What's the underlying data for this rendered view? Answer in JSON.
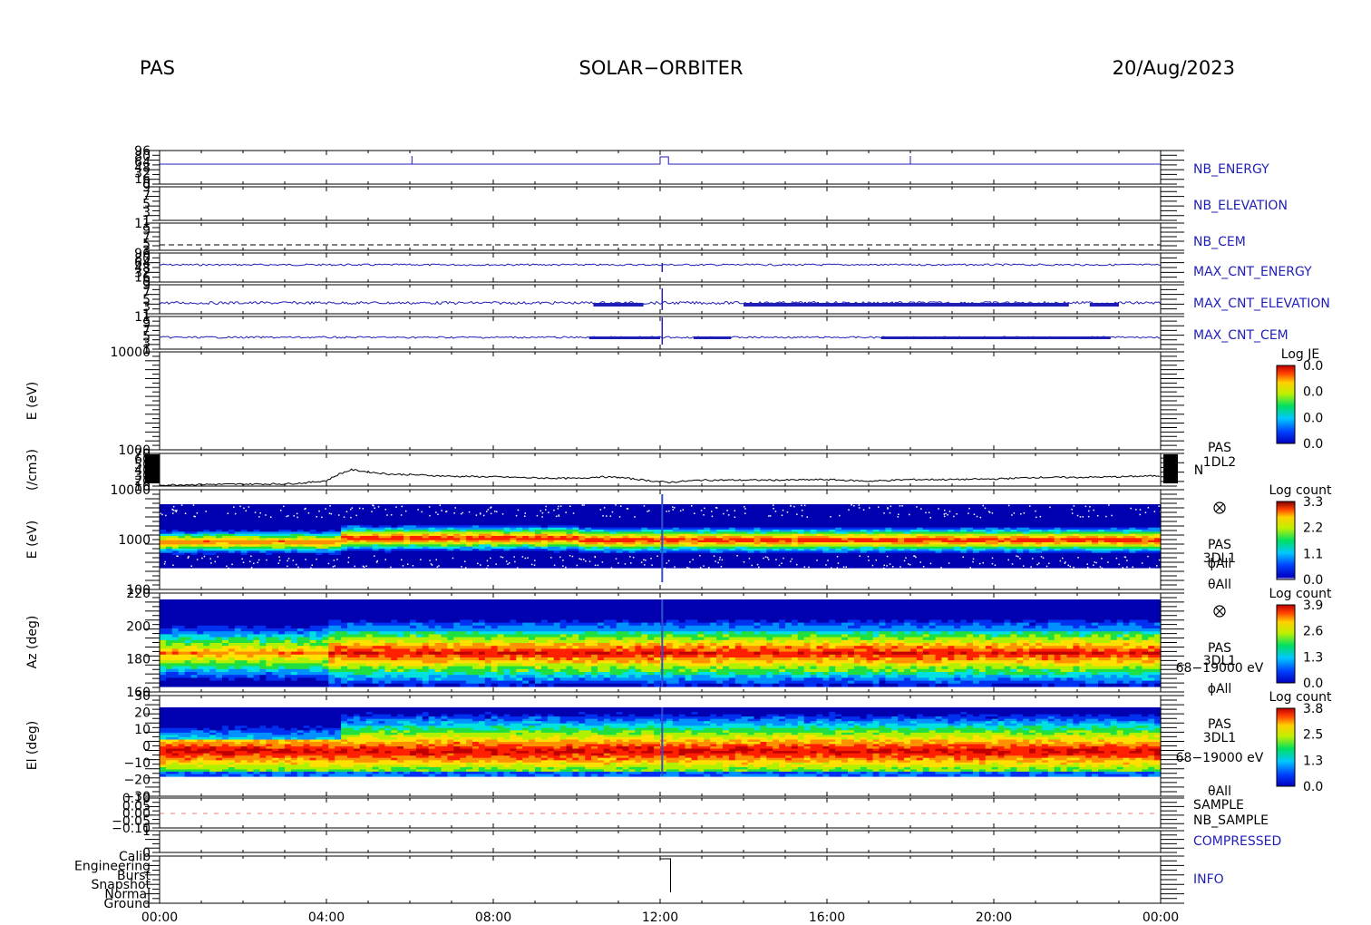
{
  "header": {
    "instrument": "PAS",
    "mission": "SOLAR−ORBITER",
    "date": "20/Aug/2023"
  },
  "colors": {
    "trace_blue": "#1f1fb8",
    "nb_sample_red": "#d81e1e",
    "background": "#ffffff"
  },
  "chart_data": [
    {
      "type": "line",
      "name": "NB_ENERGY",
      "label": "NB_ENERGY",
      "ytick_labels": [
        "96",
        "80",
        "64",
        "48",
        "32",
        "16",
        "0"
      ],
      "x_hours": [
        0,
        6.0,
        6.02,
        12.0,
        12.15,
        18.0,
        18.02,
        24
      ],
      "y_norm": [
        0.9,
        0.9,
        0.55,
        0.92,
        0.6,
        0.6,
        0.9,
        0.6
      ],
      "color": "#1f1fb8"
    },
    {
      "type": "line",
      "name": "NB_ELEVATION",
      "label": "NB_ELEVATION",
      "ytick_labels": [
        "9",
        "7",
        "5",
        "3",
        "1"
      ],
      "color": "#1f1fb8"
    },
    {
      "type": "line",
      "name": "NB_CEM",
      "label": "NB_CEM",
      "ytick_labels": [
        "11",
        "9",
        "7",
        "5",
        "3"
      ],
      "color": "#1f1fb8"
    },
    {
      "type": "line",
      "name": "MAX_CNT_ENERGY",
      "label": "MAX_CNT_ENERGY",
      "ytick_labels": [
        "96",
        "80",
        "64",
        "48",
        "32",
        "16",
        "0"
      ],
      "color": "#1f1fb8"
    },
    {
      "type": "line",
      "name": "MAX_CNT_ELEVATION",
      "label": "MAX_CNT_ELEVATION",
      "ytick_labels": [
        "9",
        "7",
        "5",
        "3",
        "1"
      ],
      "color": "#1f1fb8"
    },
    {
      "type": "line",
      "name": "MAX_CNT_CEM",
      "label": "MAX_CNT_CEM",
      "ytick_labels": [
        "11",
        "9",
        "7",
        "5",
        "3",
        "1"
      ],
      "color": "#1f1fb8"
    },
    {
      "type": "heatmap",
      "name": "1DL2 energy spectrogram",
      "ylabel": "E (eV)",
      "ytick_labels": [
        "10000",
        "1000"
      ],
      "colorbar": {
        "title": "Log JE",
        "ticks": [
          "0.0",
          "0.0",
          "0.0",
          "0.0"
        ]
      }
    },
    {
      "type": "line",
      "name": "density",
      "ylabel": "(/cm3)",
      "label_lines": [
        "PAS",
        "1DL2",
        "N"
      ],
      "ytick_labels": [
        "70",
        "60",
        "50",
        "40",
        "30",
        "20",
        "10"
      ],
      "ylim": [
        10,
        70
      ],
      "x_hours": [
        0,
        1,
        2,
        3,
        3.5,
        4.0,
        4.3,
        4.6,
        5.0,
        5.5,
        6,
        7,
        8,
        9,
        10,
        10.5,
        11,
        11.5,
        12,
        12.2,
        13,
        14,
        15,
        16,
        17,
        18,
        19,
        20,
        21,
        22,
        23,
        23.5,
        24
      ],
      "y": [
        12,
        13,
        13.5,
        14,
        16,
        20,
        32,
        40,
        36,
        32,
        31,
        28,
        27,
        25,
        24,
        27,
        26,
        22,
        18,
        17,
        21,
        21,
        21,
        22,
        19,
        22,
        22,
        23,
        26,
        26,
        27,
        28,
        29
      ],
      "color": "#000000"
    },
    {
      "type": "heatmap",
      "name": "3DL1 energy spectrogram",
      "ylabel": "E (eV)",
      "label_lines": [
        "PAS",
        "3DL1",
        "ϕAll",
        "θAll"
      ],
      "ytick_labels": [
        "10000",
        "1000",
        "100"
      ],
      "colorbar": {
        "title": "Log count",
        "ticks": [
          "3.3",
          "2.2",
          "1.1",
          "0.0"
        ]
      }
    },
    {
      "type": "heatmap",
      "name": "azimuth spectrogram",
      "ylabel": "Az (deg)",
      "label_lines": [
        "PAS",
        "3DL1",
        "68−19000 eV",
        "ϕAll"
      ],
      "ytick_labels": [
        "220",
        "200",
        "180",
        "160"
      ],
      "colorbar": {
        "title": "Log count",
        "ticks": [
          "3.9",
          "2.6",
          "1.3",
          "0.0"
        ]
      }
    },
    {
      "type": "heatmap",
      "name": "elevation spectrogram",
      "ylabel": "El (deg)",
      "label_lines": [
        "PAS",
        "3DL1",
        "68−19000 eV",
        "θAll"
      ],
      "ytick_labels": [
        "30",
        "20",
        "10",
        "0",
        "−10",
        "−20",
        "−30"
      ],
      "colorbar": {
        "title": "Log count",
        "ticks": [
          "3.8",
          "2.5",
          "1.3",
          "0.0"
        ]
      }
    },
    {
      "type": "line",
      "name": "SAMPLE",
      "label_lines": [
        "SAMPLE",
        "NB_SAMPLE"
      ],
      "ytick_labels": [
        "0.10",
        "0.05",
        "0.00",
        "−0.05",
        "−0.10"
      ]
    },
    {
      "type": "line",
      "name": "COMPRESSED",
      "label": "COMPRESSED",
      "ytick_labels": [
        "1",
        "0"
      ]
    },
    {
      "type": "line",
      "name": "INFO",
      "label": "INFO",
      "ytick_labels": [
        "Calib",
        "Engineering",
        "Burst",
        "Snapshot",
        "Normal",
        "Ground"
      ]
    }
  ],
  "xaxis": {
    "tick_labels": [
      "00:00",
      "04:00",
      "08:00",
      "12:00",
      "16:00",
      "20:00",
      "00:00"
    ],
    "range_hours": [
      0,
      24
    ]
  }
}
